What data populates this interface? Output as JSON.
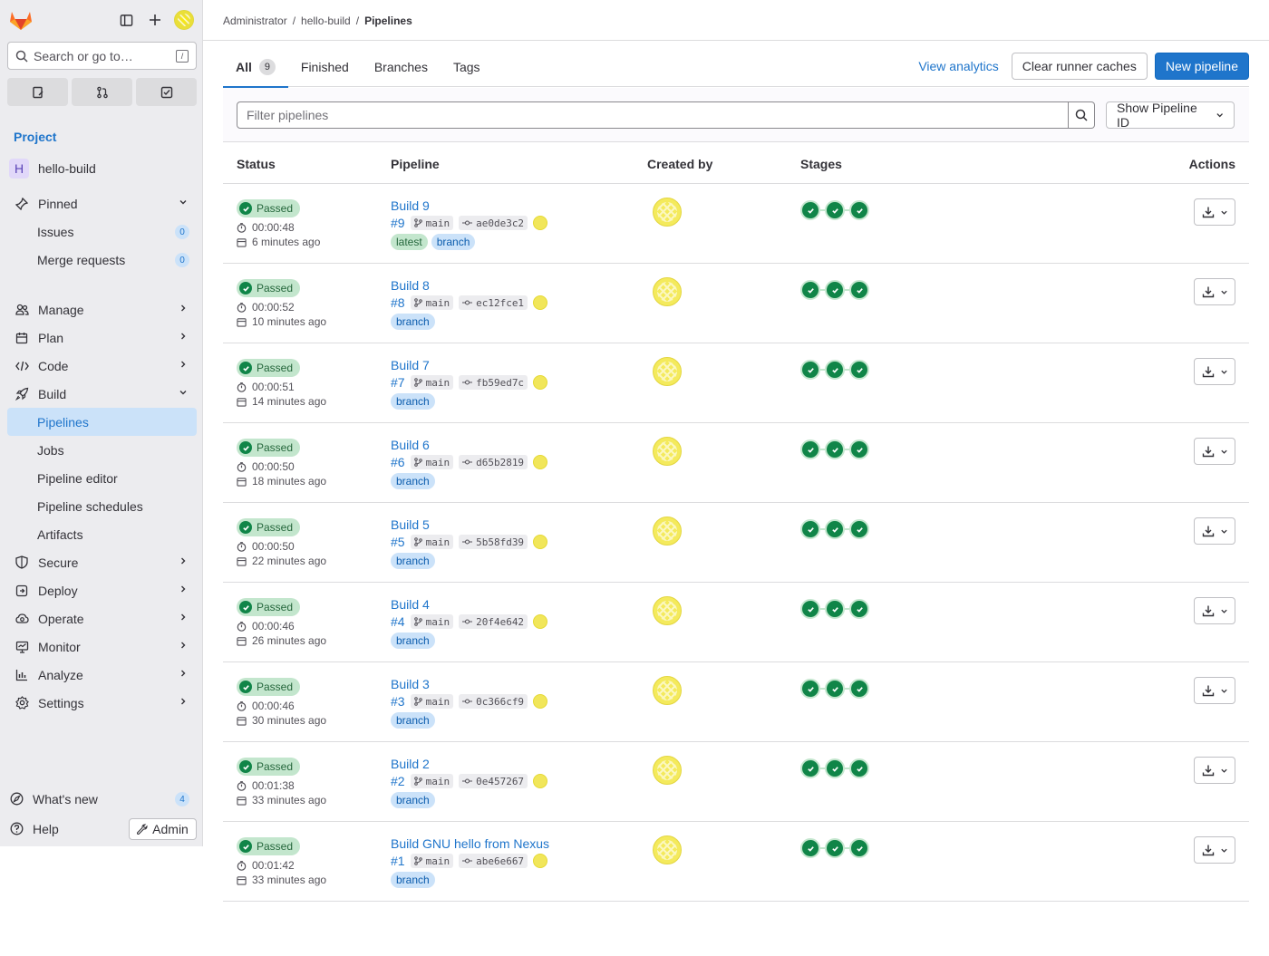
{
  "sidebar": {
    "search_placeholder": "Search or go to…",
    "search_kbd": "/",
    "section_title": "Project",
    "project": {
      "initial": "H",
      "name": "hello-build"
    },
    "items": [
      {
        "label": "Pinned",
        "icon": "pin-icon",
        "expanded": true
      },
      {
        "label": "Issues",
        "sub": true,
        "count": "0"
      },
      {
        "label": "Merge requests",
        "sub": true,
        "count": "0"
      },
      {
        "label": "Manage",
        "icon": "users-icon"
      },
      {
        "label": "Plan",
        "icon": "calendar-icon"
      },
      {
        "label": "Code",
        "icon": "code-icon"
      },
      {
        "label": "Build",
        "icon": "rocket-icon",
        "expanded": true
      },
      {
        "label": "Pipelines",
        "sub": true,
        "active": true
      },
      {
        "label": "Jobs",
        "sub": true
      },
      {
        "label": "Pipeline editor",
        "sub": true
      },
      {
        "label": "Pipeline schedules",
        "sub": true
      },
      {
        "label": "Artifacts",
        "sub": true
      },
      {
        "label": "Secure",
        "icon": "shield-icon"
      },
      {
        "label": "Deploy",
        "icon": "deploy-icon"
      },
      {
        "label": "Operate",
        "icon": "cloud-icon"
      },
      {
        "label": "Monitor",
        "icon": "monitor-icon"
      },
      {
        "label": "Analyze",
        "icon": "chart-icon"
      },
      {
        "label": "Settings",
        "icon": "gear-icon"
      }
    ],
    "whats_new": {
      "label": "What's new",
      "count": "4"
    },
    "help": "Help",
    "admin": "Admin"
  },
  "breadcrumb": [
    "Administrator",
    "hello-build",
    "Pipelines"
  ],
  "tabs": [
    {
      "label": "All",
      "count": "9",
      "active": true
    },
    {
      "label": "Finished"
    },
    {
      "label": "Branches"
    },
    {
      "label": "Tags"
    }
  ],
  "actions": {
    "analytics": "View analytics",
    "clear_cache": "Clear runner caches",
    "new_pipeline": "New pipeline"
  },
  "filter": {
    "placeholder": "Filter pipelines",
    "select": "Show Pipeline ID"
  },
  "table": {
    "headers": [
      "Status",
      "Pipeline",
      "Created by",
      "Stages",
      "Actions"
    ],
    "rows": [
      {
        "status": "Passed",
        "duration": "00:00:48",
        "ago": "6 minutes ago",
        "title": "Build 9",
        "num": "#9",
        "branch": "main",
        "sha": "ae0de3c2",
        "labels": [
          "latest",
          "branch"
        ]
      },
      {
        "status": "Passed",
        "duration": "00:00:52",
        "ago": "10 minutes ago",
        "title": "Build 8",
        "num": "#8",
        "branch": "main",
        "sha": "ec12fce1",
        "labels": [
          "branch"
        ]
      },
      {
        "status": "Passed",
        "duration": "00:00:51",
        "ago": "14 minutes ago",
        "title": "Build 7",
        "num": "#7",
        "branch": "main",
        "sha": "fb59ed7c",
        "labels": [
          "branch"
        ]
      },
      {
        "status": "Passed",
        "duration": "00:00:50",
        "ago": "18 minutes ago",
        "title": "Build 6",
        "num": "#6",
        "branch": "main",
        "sha": "d65b2819",
        "labels": [
          "branch"
        ]
      },
      {
        "status": "Passed",
        "duration": "00:00:50",
        "ago": "22 minutes ago",
        "title": "Build 5",
        "num": "#5",
        "branch": "main",
        "sha": "5b58fd39",
        "labels": [
          "branch"
        ]
      },
      {
        "status": "Passed",
        "duration": "00:00:46",
        "ago": "26 minutes ago",
        "title": "Build 4",
        "num": "#4",
        "branch": "main",
        "sha": "20f4e642",
        "labels": [
          "branch"
        ]
      },
      {
        "status": "Passed",
        "duration": "00:00:46",
        "ago": "30 minutes ago",
        "title": "Build 3",
        "num": "#3",
        "branch": "main",
        "sha": "0c366cf9",
        "labels": [
          "branch"
        ]
      },
      {
        "status": "Passed",
        "duration": "00:01:38",
        "ago": "33 minutes ago",
        "title": "Build 2",
        "num": "#2",
        "branch": "main",
        "sha": "0e457267",
        "labels": [
          "branch"
        ]
      },
      {
        "status": "Passed",
        "duration": "00:01:42",
        "ago": "33 minutes ago",
        "title": "Build GNU hello from Nexus",
        "num": "#1",
        "branch": "main",
        "sha": "abe6e667",
        "labels": [
          "branch"
        ]
      }
    ]
  }
}
